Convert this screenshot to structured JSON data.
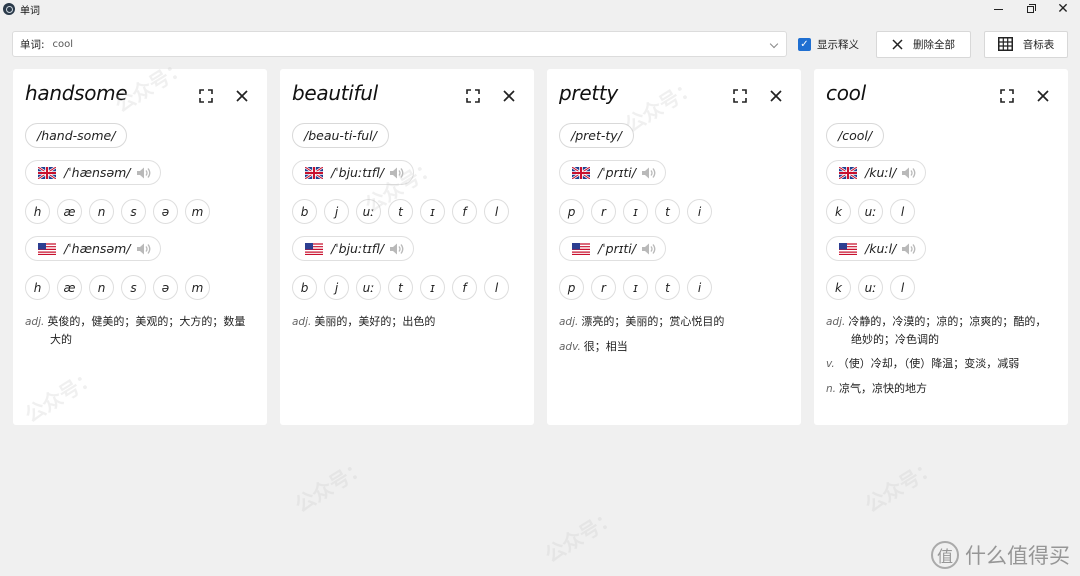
{
  "window": {
    "title": "单词",
    "minimize_glyph": "",
    "restore_glyph": "",
    "close_glyph": "✕"
  },
  "toolbar": {
    "word_label": "单词:",
    "word_value": "cool",
    "show_definitions_label": "显示释义",
    "show_definitions_checked": true,
    "delete_all_label": "删除全部",
    "phonetic_table_label": "音标表"
  },
  "colors": {
    "accent": "#1f6fd1",
    "background": "#f0f0f0",
    "card": "#ffffff"
  },
  "cards": [
    {
      "word": "handsome",
      "syllables": "/hand-some/",
      "uk": {
        "ipa": "/ˈhænsəm/",
        "phonemes": [
          "h",
          "æ",
          "n",
          "s",
          "ə",
          "m"
        ]
      },
      "us": {
        "ipa": "/ˈhænsəm/",
        "phonemes": [
          "h",
          "æ",
          "n",
          "s",
          "ə",
          "m"
        ]
      },
      "definitions": [
        {
          "pos": "adj.",
          "text": "英俊的，健美的；美观的；大方的；数量大的"
        }
      ]
    },
    {
      "word": "beautiful",
      "syllables": "/beau-ti-ful/",
      "uk": {
        "ipa": "/ˈbjuːtɪfl/",
        "phonemes": [
          "b",
          "j",
          "uː",
          "t",
          "ɪ",
          "f",
          "l"
        ]
      },
      "us": {
        "ipa": "/ˈbjuːtɪfl/",
        "phonemes": [
          "b",
          "j",
          "uː",
          "t",
          "ɪ",
          "f",
          "l"
        ]
      },
      "definitions": [
        {
          "pos": "adj.",
          "text": "美丽的，美好的；出色的"
        }
      ]
    },
    {
      "word": "pretty",
      "syllables": "/pret-ty/",
      "uk": {
        "ipa": "/ˈprɪti/",
        "phonemes": [
          "p",
          "r",
          "ɪ",
          "t",
          "i"
        ]
      },
      "us": {
        "ipa": "/ˈprɪti/",
        "phonemes": [
          "p",
          "r",
          "ɪ",
          "t",
          "i"
        ]
      },
      "definitions": [
        {
          "pos": "adj.",
          "text": "漂亮的；美丽的；赏心悦目的"
        },
        {
          "pos": "adv.",
          "text": "很；相当"
        }
      ]
    },
    {
      "word": "cool",
      "syllables": "/cool/",
      "uk": {
        "ipa": "/kuːl/",
        "phonemes": [
          "k",
          "uː",
          "l"
        ]
      },
      "us": {
        "ipa": "/kuːl/",
        "phonemes": [
          "k",
          "uː",
          "l"
        ]
      },
      "definitions": [
        {
          "pos": "adj.",
          "text": "冷静的，冷漠的；凉的；凉爽的；酷的，绝妙的；冷色调的"
        },
        {
          "pos": "v.",
          "text": "（使）冷却，（使）降温；变淡，减弱"
        },
        {
          "pos": "n.",
          "text": "凉气，凉快的地方"
        }
      ]
    }
  ],
  "icons": {
    "expand": "expand-icon",
    "close": "close-icon",
    "speaker": "speaker-icon",
    "uk_flag": "uk-flag-icon",
    "us_flag": "us-flag-icon"
  },
  "watermark": {
    "text": "公众号：",
    "brand": "什么值得买",
    "brand_badge": "值"
  }
}
